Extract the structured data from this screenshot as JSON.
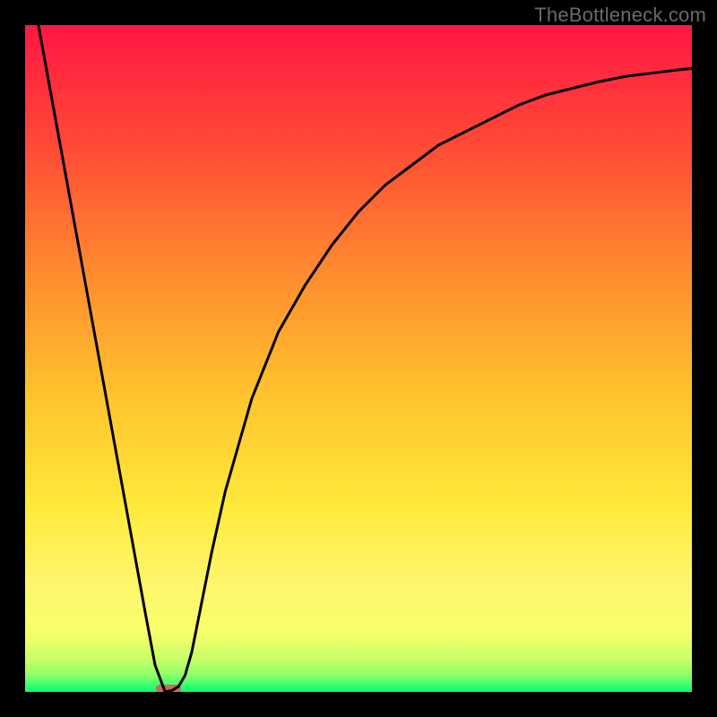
{
  "watermark": "TheBottleneck.com",
  "chart_data": {
    "type": "line",
    "title": "",
    "xlabel": "",
    "ylabel": "",
    "xlim": [
      0,
      100
    ],
    "ylim": [
      0,
      100
    ],
    "grid": false,
    "axes_visible": false,
    "background_gradient": {
      "top_color": "#ff1643",
      "bottom_color": "#00ff73",
      "mid_colors": [
        "#ff6a2e",
        "#ffb52c",
        "#ffe83a",
        "#fff66d"
      ]
    },
    "series": [
      {
        "name": "bottleneck-curve",
        "color": "#000000",
        "width": 3,
        "x": [
          2,
          4,
          6,
          8,
          10,
          12,
          14,
          16,
          18,
          19.5,
          21,
          22,
          23,
          24,
          25,
          26,
          28,
          30,
          34,
          38,
          42,
          46,
          50,
          54,
          58,
          62,
          66,
          70,
          74,
          78,
          82,
          86,
          90,
          94,
          98,
          100
        ],
        "y": [
          100,
          89,
          78,
          67,
          56,
          45,
          34,
          23,
          12,
          4,
          0,
          0.2,
          0.8,
          2.5,
          6,
          11,
          21,
          30,
          44,
          54,
          61,
          67,
          72,
          76,
          79,
          82,
          84,
          86,
          88,
          89.5,
          90.5,
          91.5,
          92.3,
          92.8,
          93.3,
          93.5
        ]
      }
    ],
    "marker_zone": {
      "name": "sweet-spot-marker",
      "color": "#cc6666",
      "x": 21.5,
      "width": 3.8,
      "y": 0.5,
      "height": 1.2
    }
  }
}
